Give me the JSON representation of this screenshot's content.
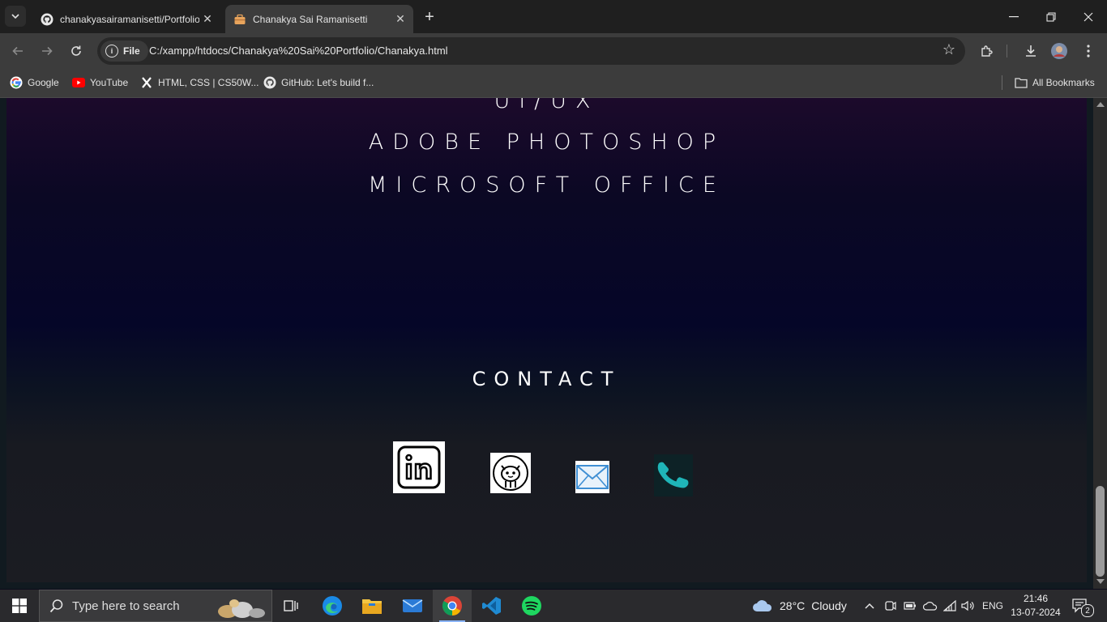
{
  "browser": {
    "tabs": [
      {
        "title": "chanakyasairamanisetti/Portfolio",
        "favicon": "github-icon",
        "active": false
      },
      {
        "title": "Chanakya Sai Ramanisetti",
        "favicon": "briefcase-icon",
        "active": true
      }
    ],
    "address": {
      "chip_label": "File",
      "url": "C:/xampp/htdocs/Chanakya%20Sai%20Portfolio/Chanakya.html"
    },
    "bookmarks": [
      {
        "label": "Google",
        "icon": "google-icon"
      },
      {
        "label": "YouTube",
        "icon": "youtube-icon"
      },
      {
        "label": "HTML, CSS | CS50W...",
        "icon": "x-icon"
      },
      {
        "label": "GitHub: Let's build f...",
        "icon": "github-icon"
      }
    ],
    "all_bookmarks_label": "All Bookmarks"
  },
  "page": {
    "skills_visible": [
      "UI/UX",
      "ADOBE PHOTOSHOP",
      "MICROSOFT OFFICE"
    ],
    "contact_title": "CONTACT",
    "contact_icons": [
      "linkedin-icon",
      "github-cat-icon",
      "mail-icon",
      "phone-icon"
    ],
    "colors": {
      "accent_phone": "#1fb5b8",
      "text": "#ffffff"
    }
  },
  "taskbar": {
    "search_placeholder": "Type here to search",
    "weather": {
      "temp": "28°C",
      "condition": "Cloudy"
    },
    "language": "ENG",
    "time": "21:46",
    "date": "13-07-2024",
    "notification_count": "2"
  }
}
